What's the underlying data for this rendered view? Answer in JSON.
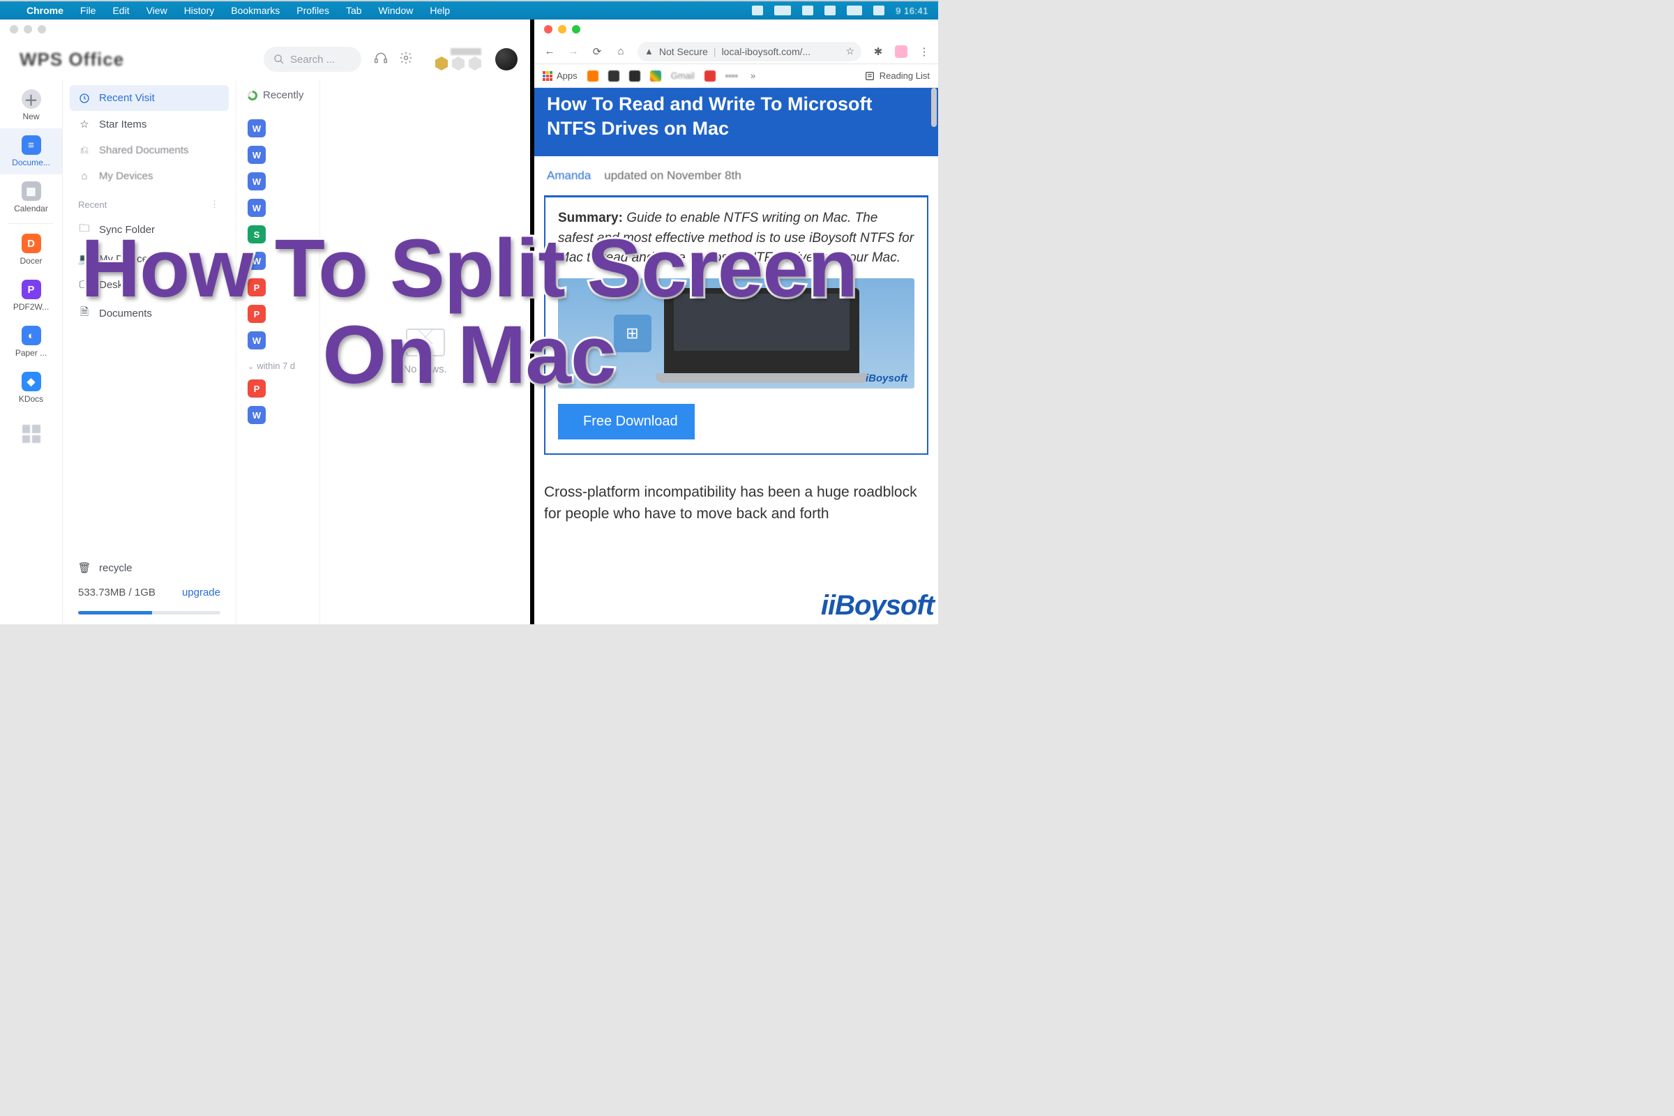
{
  "menubar": {
    "app": "Chrome",
    "items": [
      "File",
      "Edit",
      "View",
      "History",
      "Bookmarks",
      "Profiles",
      "Tab",
      "Window",
      "Help"
    ],
    "clock": "9  16:41"
  },
  "overlay": {
    "line1": "How To Split Screen",
    "line2": "On Mac"
  },
  "left": {
    "brand": "WPS Office",
    "search_placeholder": "Search ...",
    "rail": [
      {
        "label": "New"
      },
      {
        "label": "Docume..."
      },
      {
        "label": "Calendar"
      },
      {
        "label": "Docer"
      },
      {
        "label": "PDF2W..."
      },
      {
        "label": "Paper ..."
      },
      {
        "label": "KDocs"
      }
    ],
    "nav": {
      "recent_visit": "Recent Visit",
      "star": "Star Items",
      "share": "Shared Documents",
      "device": "My Devices",
      "recent_hdr": "Recent",
      "sync": "Sync Folder",
      "mydev": "My Device",
      "desktop": "Desktop",
      "documents": "Documents",
      "recycle": "recycle",
      "storage": "533.73MB / 1GB",
      "upgrade": "upgrade"
    },
    "col3": {
      "top": "Recently",
      "within": "within 7 d"
    },
    "col4": {
      "empty": "No news."
    }
  },
  "right": {
    "omni": {
      "ns": "Not Secure",
      "url": "local-iboysoft.com/..."
    },
    "bookmarks": {
      "apps": "Apps",
      "reading": "Reading List"
    },
    "hero": "How To Read and Write To Microsoft NTFS Drives on Mac",
    "meta_author": "Amanda",
    "meta_updated": "updated on November 8th",
    "summary_label": "Summary:",
    "summary_body": "Guide to enable NTFS writing on Mac. The safest and most effective method is to use iBoysoft NTFS for Mac to read and write Microsoft NTFS drives on your Mac.",
    "thumb_wm": "iBoysoft",
    "download": "Free Download",
    "below": "Cross-platform incompatibility has been a huge roadblock for people who have to move back and forth",
    "watermark": "iBoysoft"
  }
}
